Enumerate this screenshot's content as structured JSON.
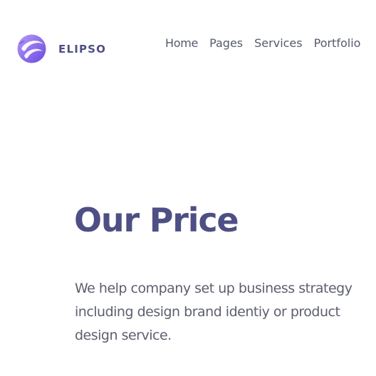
{
  "brand": {
    "name": "ELIPSO",
    "logo_icon": "swirl-sphere-logo",
    "logo_colors": [
      "#9a7bf3",
      "#6e4ee0",
      "#ffffff"
    ]
  },
  "nav": {
    "items": [
      {
        "label": "Home"
      },
      {
        "label": "Pages"
      },
      {
        "label": "Services"
      },
      {
        "label": "Portfolio"
      }
    ]
  },
  "hero": {
    "title": "Our Price",
    "description_lines": [
      "We help company set up business strategy",
      "including design brand identiy or product",
      "design service."
    ]
  },
  "colors": {
    "heading": "#4e4f84",
    "body_text": "#5c5f6e",
    "nav_text": "#555a6c",
    "background": "#ffffff"
  }
}
